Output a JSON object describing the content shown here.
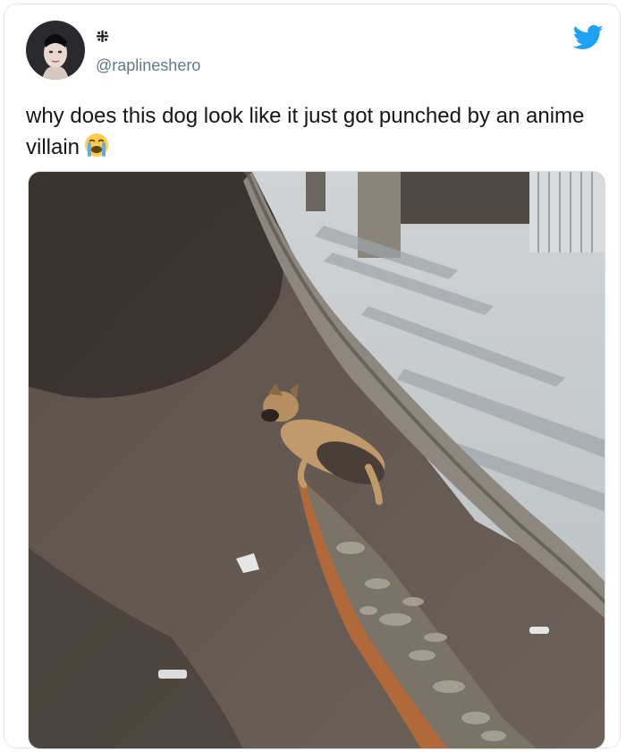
{
  "tweet": {
    "display_name": "⁜",
    "handle": "@raplineshero",
    "text": "why does this dog look like it just got punched by an anime villain",
    "emoji_icon": "loudly-crying-face-emoji",
    "brand_icon": "twitter-bird-icon",
    "brand_color": "#1da1f2"
  },
  "media": {
    "subject": "photo"
  }
}
